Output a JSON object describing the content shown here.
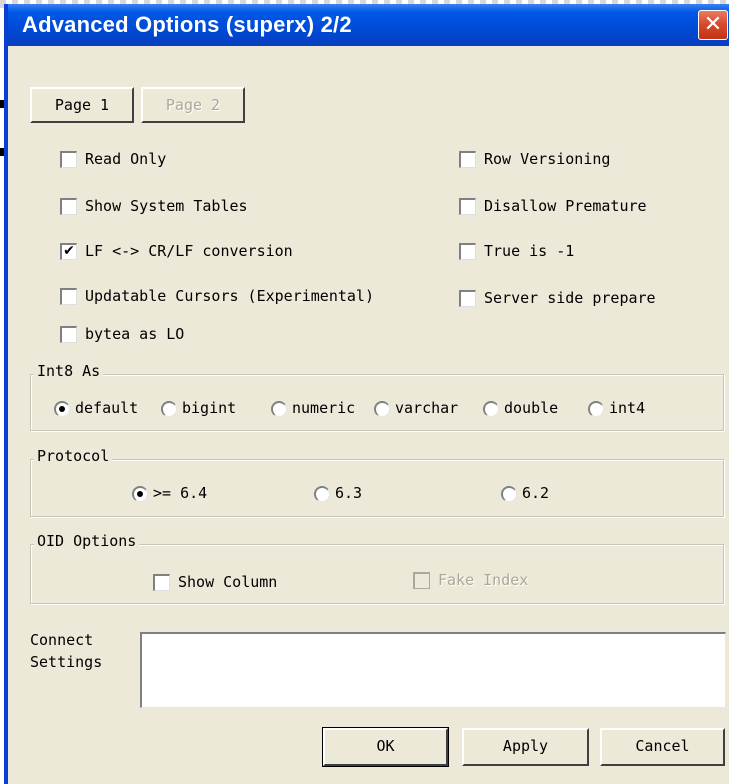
{
  "window": {
    "title": "Advanced Options (superx) 2/2",
    "close_glyph": "✕"
  },
  "pages": {
    "page1_label": "Page 1",
    "page2_label": "Page 2"
  },
  "checkboxes": {
    "read_only": {
      "label": "Read Only",
      "checked": false
    },
    "show_system_tables": {
      "label": "Show System Tables",
      "checked": false
    },
    "lf_crlf": {
      "label": "LF <-> CR/LF conversion",
      "checked": true,
      "mark": "✔"
    },
    "updatable_cursors": {
      "label": "Updatable Cursors (Experimental)",
      "checked": false
    },
    "bytea_as_lo": {
      "label": "bytea as LO",
      "checked": false
    },
    "row_versioning": {
      "label": "Row Versioning",
      "checked": false
    },
    "disallow_premature": {
      "label": "Disallow Premature",
      "checked": false
    },
    "true_is_minus1": {
      "label": "True is -1",
      "checked": false
    },
    "server_side_prepare": {
      "label": "Server side prepare",
      "checked": false
    }
  },
  "int8": {
    "legend": "Int8 As",
    "options": [
      "default",
      "bigint",
      "numeric",
      "varchar",
      "double",
      "int4"
    ],
    "selected": "default"
  },
  "protocol": {
    "legend": "Protocol",
    "options": [
      ">= 6.4",
      "6.3",
      "6.2"
    ],
    "selected": ">= 6.4"
  },
  "oid": {
    "legend": "OID Options",
    "show_column": "Show Column",
    "fake_index": "Fake Index"
  },
  "connect": {
    "label_line1": "Connect",
    "label_line2": "Settings",
    "value": ""
  },
  "buttons": {
    "ok": "OK",
    "apply": "Apply",
    "cancel": "Cancel"
  },
  "colors": {
    "title_blue": "#0047d1",
    "dialog_face": "#ece9d8",
    "close_red": "#d8462a"
  }
}
